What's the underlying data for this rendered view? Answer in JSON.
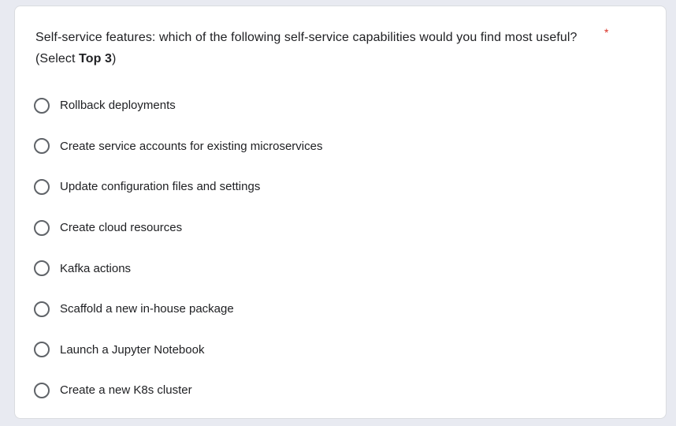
{
  "question": {
    "text_before": "Self-service features: which of the following self-service capabilities would you find most useful? (Select ",
    "text_bold": "Top 3",
    "text_after": ")",
    "required_mark": "*"
  },
  "options": [
    {
      "label": "Rollback deployments"
    },
    {
      "label": "Create service accounts for existing microservices"
    },
    {
      "label": "Update configuration files and settings"
    },
    {
      "label": "Create cloud resources"
    },
    {
      "label": "Kafka actions"
    },
    {
      "label": "Scaffold a new in-house package"
    },
    {
      "label": "Launch a Jupyter Notebook"
    },
    {
      "label": "Create a new K8s cluster"
    }
  ],
  "colors": {
    "background": "#e8eaf1",
    "card": "#ffffff",
    "required": "#d93025",
    "radio_border": "#5f6368"
  }
}
